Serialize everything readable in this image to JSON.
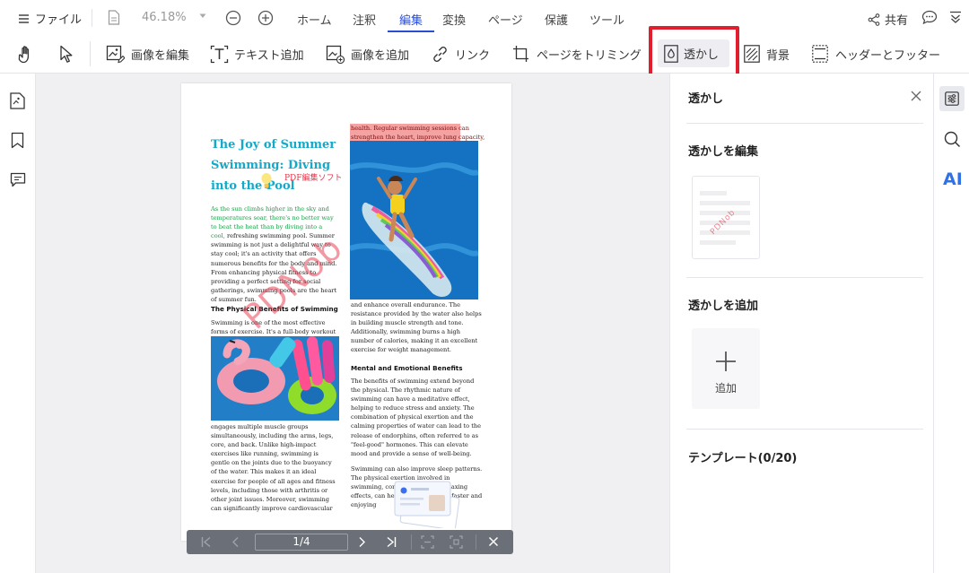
{
  "top": {
    "file_menu": "ファイル",
    "zoom": "46.18%",
    "tabs": [
      "ホーム",
      "注釈",
      "編集",
      "変換",
      "ページ",
      "保護",
      "ツール"
    ],
    "active_tab_index": 2,
    "share": "共有"
  },
  "toolbar": {
    "edit_image": "画像を編集",
    "add_text": "テキスト追加",
    "add_image": "画像を追加",
    "link": "リンク",
    "crop_page": "ページをトリミング",
    "watermark": "透かし",
    "background": "背景",
    "header_footer": "ヘッダーとフッター"
  },
  "colors": {
    "accent": "#2a4dd8",
    "highlight_box": "#e01e2e",
    "title_cyan": "#14a9c9",
    "watermark_red": "#e8344a"
  },
  "document": {
    "title": "The Joy of Summer Swimming: Diving into the Pool",
    "watermark_side_text": "PDF編集ソフト",
    "watermark_diagonal": "PDNob",
    "intro_green": "As the sun climbs higher in the sky and temperatures soar, there's no better way to beat the heat than by diving into a cool,",
    "intro_rest": "refreshing swimming pool. Summer swimming is not just a delightful way to stay cool; it's an activity that offers numerous benefits for the body and mind. From enhancing physical fitness to providing a perfect setting for social gatherings, swimming pools are the heart of summer fun.",
    "heading_physical": "The Physical Benefits of Swimming",
    "physical_text": "Swimming is one of the most effective forms of exercise. It's a full-body workout that",
    "physical_text2": "engages multiple muscle groups simultaneously, including the arms, legs, core, and back. Unlike high-impact exercises like running, swimming is gentle on the joints due to the buoyancy of the water. This makes it an ideal exercise for people of all ages and fitness levels, including those with arthritis or other joint issues. Moreover, swimming can significantly improve cardiovascular",
    "right_highlight": "health. Regular swimming sessions can strengthen the heart, improve lung capacity,",
    "right_text1": "and enhance overall endurance. The resistance provided by the water also helps in building muscle strength and tone. Additionally, swimming burns a high number of calories, making it an excellent exercise for weight management.",
    "heading_mental": "Mental and Emotional Benefits",
    "mental_text": "The benefits of swimming extend beyond the physical. The rhythmic nature of swimming can have a meditative effect, helping to reduce stress and anxiety. The combination of physical exertion and the calming properties of water can lead to the release of endorphins, often referred to as \"feel-good\" hormones. This can elevate mood and provide a sense of well-being.",
    "sleep_text": "Swimming can also improve sleep patterns. The physical exertion involved in swimming, combined with the relaxing effects, can help in falling asleep faster and enjoying"
  },
  "pager": {
    "indicator": "1/4"
  },
  "panel": {
    "title": "透かし",
    "edit_section": "透かしを編集",
    "thumb_watermark": "PDNob",
    "add_section": "透かしを追加",
    "add_label": "追加",
    "template_section": "テンプレート(0/20)"
  },
  "right_sidebar": {
    "ai_label": "AI"
  }
}
